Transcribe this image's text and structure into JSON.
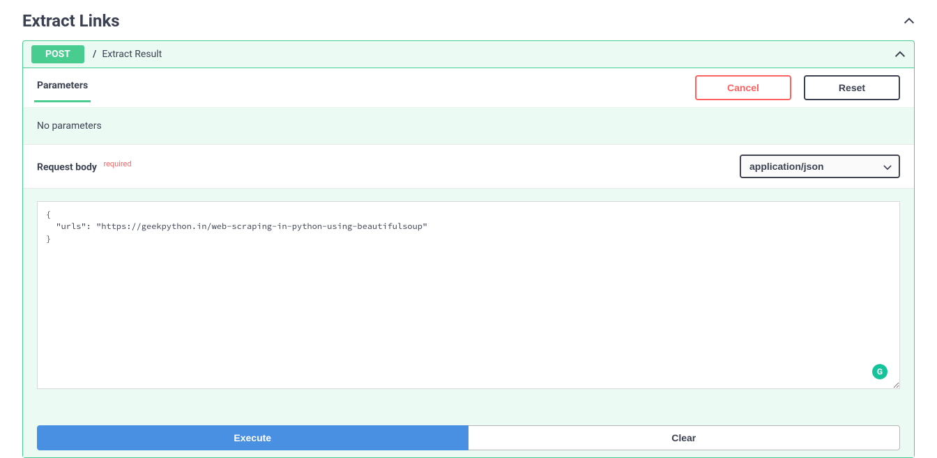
{
  "section": {
    "title": "Extract Links"
  },
  "endpoint": {
    "method": "POST",
    "path_prefix": "/",
    "summary": "Extract Result"
  },
  "tabs": {
    "parameters": "Parameters"
  },
  "buttons": {
    "cancel": "Cancel",
    "reset": "Reset",
    "execute": "Execute",
    "clear": "Clear"
  },
  "parameters": {
    "no_params_text": "No parameters"
  },
  "request_body": {
    "label": "Request body",
    "required_text": "required",
    "content_type_options": [
      "application/json"
    ],
    "content_type_selected": "application/json",
    "example_value": "{\n  \"urls\": \"https://geekpython.in/web-scraping-in-python-using-beautifulsoup\"\n}"
  },
  "grammarly": {
    "icon_letter": "G"
  }
}
